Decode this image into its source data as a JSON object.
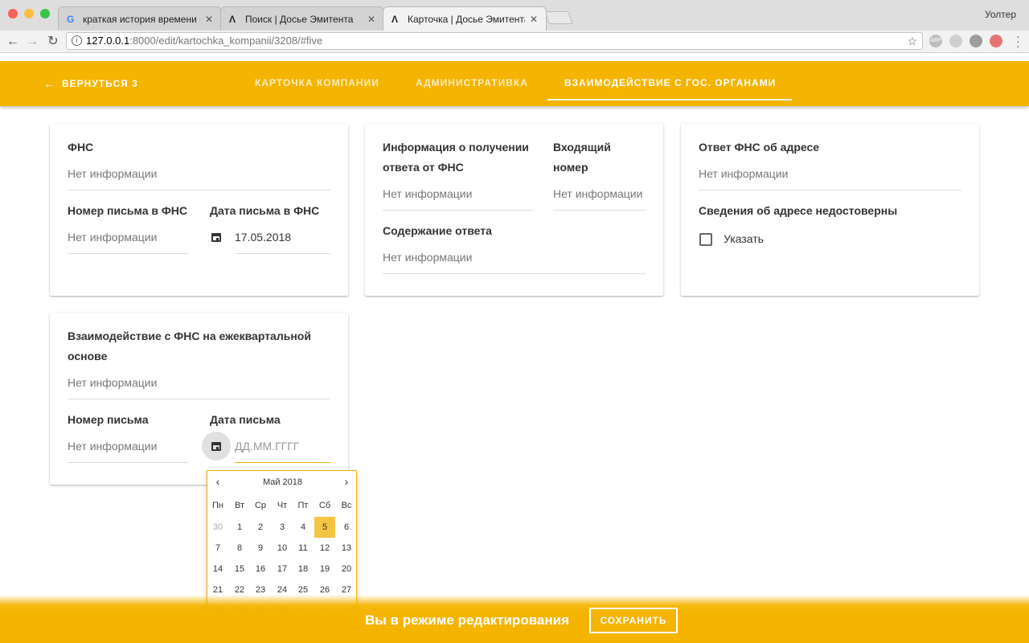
{
  "browser": {
    "tabs": [
      {
        "label": "краткая история времени - П",
        "favicon": "G"
      },
      {
        "label": "Поиск | Досье Эмитента",
        "favicon": "Λ"
      },
      {
        "label": "Карточка | Досье Эмитента",
        "favicon": "Λ"
      }
    ],
    "active_tab": 2,
    "user": "Уолтер",
    "url_host": "127.0.0.1",
    "url_rest": ":8000/edit/kartochka_kompanii/3208/#five"
  },
  "header": {
    "back_label": "ВЕРНУТЬСЯ 3",
    "tabs": [
      "КАРТОЧКА КОМПАНИИ",
      "АДМИНИСТРАТИВКА",
      "ВЗАИМОДЕЙСТВИЕ С ГОС. ОРГАНАМИ"
    ],
    "active_index": 2
  },
  "card_fns": {
    "title": "ФНС",
    "title_value": "Нет информации",
    "letter_no_label": "Номер письма в ФНС",
    "letter_no_value": "Нет информации",
    "letter_date_label": "Дата письма в ФНС",
    "letter_date_value": "17.05.2018"
  },
  "card_response": {
    "info_label_1": "Информация о получении",
    "info_label_2": "ответа от ФНС",
    "info_value": "Нет информации",
    "incoming_label_1": "Входящий",
    "incoming_label_2": "номер",
    "incoming_value": "Нет информации",
    "content_label": "Содержание ответа",
    "content_value": "Нет информации"
  },
  "card_address": {
    "answer_label": "Ответ ФНС об адресе",
    "answer_value": "Нет информации",
    "unreliable_label": "Сведения об адресе недостоверны",
    "checkbox_label": "Указать"
  },
  "card_quarterly": {
    "title_1": "Взаимодействие с ФНС на ежеквартальной",
    "title_2": "основе",
    "title_value": "Нет информации",
    "letter_no_label": "Номер письма",
    "letter_no_value": "Нет информации",
    "letter_date_label": "Дата письма",
    "letter_date_placeholder": "ДД.ММ.ГГГГ"
  },
  "datepicker": {
    "month_label": "Май 2018",
    "prev": "‹",
    "next": "›",
    "weekdays": [
      "Пн",
      "Вт",
      "Ср",
      "Чт",
      "Пт",
      "Сб",
      "Вс"
    ],
    "weeks": [
      [
        "30",
        "1",
        "2",
        "3",
        "4",
        "5",
        "6"
      ],
      [
        "7",
        "8",
        "9",
        "10",
        "11",
        "12",
        "13"
      ],
      [
        "14",
        "15",
        "16",
        "17",
        "18",
        "19",
        "20"
      ],
      [
        "21",
        "22",
        "23",
        "24",
        "25",
        "26",
        "27"
      ],
      [
        "28",
        "29",
        "30",
        "31",
        "1",
        "2",
        "3"
      ]
    ],
    "muted_first_row": [
      0
    ],
    "muted_last_row": [
      4,
      5,
      6
    ],
    "selected_day": "5"
  },
  "footer": {
    "edit_mode_text": "Вы в режиме редактирования",
    "save_label": "СОХРАНИТЬ"
  },
  "colors": {
    "accent": "#f4b400",
    "selected_day": "#f4c542"
  }
}
